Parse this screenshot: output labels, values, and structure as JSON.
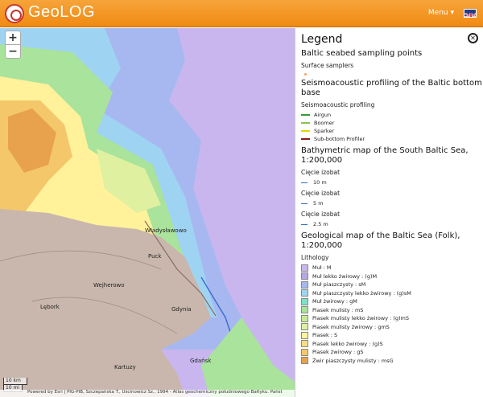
{
  "app": {
    "title": "GeoLOG",
    "menu_label": "Menu ▾"
  },
  "map": {
    "zoom_in": "+",
    "zoom_out": "−",
    "places": [
      "Władysławowo",
      "Puck",
      "Wejherowo",
      "Lębork",
      "Gdynia",
      "Gdańsk",
      "Kartuzy"
    ],
    "scale": {
      "km": "10 km",
      "mi": "10 mi"
    },
    "attribution": "Powered by Esri | PIG-PIB, Szczepańska T., Uścinowicz Sz., 1994 - Atlas geochemiczny południowego Bałtyku. Państ"
  },
  "legend": {
    "title": "Legend",
    "close_icon": "close-icon",
    "sampling": {
      "title": "Baltic seabed sampling points",
      "sub": "Surface samplers",
      "color": "#f4a460"
    },
    "seismo": {
      "title": "Seismoacoustic profiling of the Baltic bottom base",
      "sub": "Seismoacoustic profiling",
      "items": [
        {
          "label": "Airgun",
          "color": "#2e9e2e"
        },
        {
          "label": "Boomer",
          "color": "#8bc34a"
        },
        {
          "label": "Sparker",
          "color": "#e6d600"
        },
        {
          "label": "Sub-bottom Profiler",
          "color": "#8b1a1a"
        }
      ]
    },
    "bathy": {
      "title": "Bathymetric map of the South Baltic Sea, 1:200,000",
      "groups": [
        {
          "sub": "Cięcie izobat",
          "label": "10 m"
        },
        {
          "sub": "Cięcie izobat",
          "label": "5 m"
        },
        {
          "sub": "Cięcie izobat",
          "label": "2.5 m"
        }
      ]
    },
    "geo": {
      "title": "Geological map of the Baltic Sea (Folk), 1:200,000",
      "sub": "Lithology",
      "items": [
        {
          "label": "Muł : M",
          "color": "#c9b6ef"
        },
        {
          "label": "Muł lekko żwirowy : (g)M",
          "color": "#b7a6e6"
        },
        {
          "label": "Muł piaszczysty : sM",
          "color": "#a7b8f0"
        },
        {
          "label": "Muł piaszczysty lekko żwirowy : (g)sM",
          "color": "#9fd3f2"
        },
        {
          "label": "Muł żwirowy : gM",
          "color": "#7fe0c8"
        },
        {
          "label": "Piasek mulisty : mS",
          "color": "#a9e39c"
        },
        {
          "label": "Piasek mulisty lekko żwirowy : (g)mS",
          "color": "#c6eb98"
        },
        {
          "label": "Piasek mulisty żwirowy : gmS",
          "color": "#dff0a0"
        },
        {
          "label": "Piasek : S",
          "color": "#fff29a"
        },
        {
          "label": "Piasek lekko żwirowy : (g)S",
          "color": "#f7dc86"
        },
        {
          "label": "Piasek żwirowy : gS",
          "color": "#f4c76a"
        },
        {
          "label": "Żwir piaszczysty mulisty : msG",
          "color": "#e8a24e"
        }
      ]
    }
  }
}
